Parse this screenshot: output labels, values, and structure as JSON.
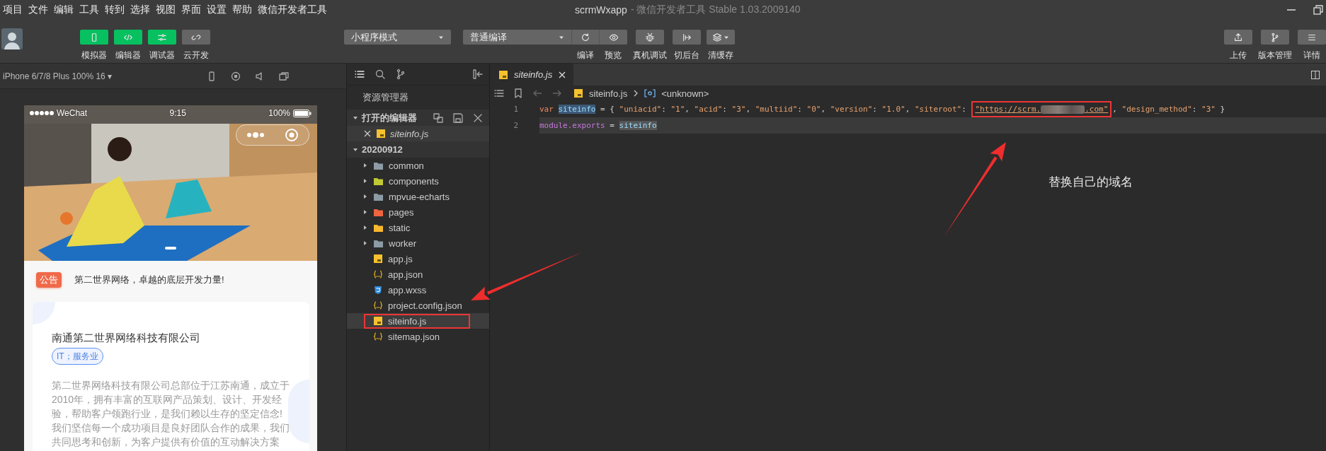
{
  "menu_bar": {
    "items": [
      "项目",
      "文件",
      "编辑",
      "工具",
      "转到",
      "选择",
      "视图",
      "界面",
      "设置",
      "帮助",
      "微信开发者工具"
    ],
    "title": "scrmWxapp",
    "subtitle": "- 微信开发者工具 Stable 1.03.2009140"
  },
  "toolbar": {
    "views": [
      {
        "label": "模拟器",
        "on": true
      },
      {
        "label": "编辑器",
        "on": true
      },
      {
        "label": "调试器",
        "on": true
      },
      {
        "label": "云开发",
        "on": false
      }
    ],
    "mode_select": "小程序模式",
    "compile": {
      "select": "普通编译",
      "buttons": [
        {
          "label": "编译"
        },
        {
          "label": "预览"
        }
      ]
    },
    "actions": [
      {
        "label": "真机调试",
        "dropdown": false
      },
      {
        "label": "切后台",
        "dropdown": false
      },
      {
        "label": "清缓存",
        "dropdown": true
      }
    ],
    "right_actions": [
      {
        "label": "上传"
      },
      {
        "label": "版本管理"
      },
      {
        "label": "详情"
      }
    ]
  },
  "simulator": {
    "device": "iPhone 6/7/8 Plus 100% 16 ▾",
    "phone": {
      "status": {
        "carrier": "WeChat",
        "time": "9:15",
        "battery": "100%"
      },
      "notice": {
        "badge": "公告",
        "text": "第二世界网络，卓越的底层开发力量!"
      },
      "company": {
        "name": "南通第二世界网络科技有限公司",
        "tag": "IT；服务业",
        "description": "第二世界网络科技有限公司总部位于江苏南通，成立于2010年，拥有丰富的互联网产品策划、设计、开发经验，帮助客户领跑行业，是我们赖以生存的坚定信念!我们坚信每一个成功项目是良好团队合作的成果，我们共同思考和创新，为客户提供有价值的互动解决方案"
      }
    }
  },
  "explorer": {
    "title": "资源管理器",
    "open_editors": {
      "label": "打开的编辑器",
      "expanded": true,
      "files": [
        {
          "name": "siteinfo.js",
          "kind": "js",
          "preview": true
        }
      ]
    },
    "project": {
      "label": "20200912",
      "expanded": true,
      "children": [
        {
          "name": "common",
          "kind": "folder",
          "color": "#8c9ba5",
          "expanded": false,
          "selected": false,
          "annotated": false
        },
        {
          "name": "components",
          "kind": "folder",
          "color": "#c0ca33",
          "expanded": false,
          "selected": false,
          "annotated": false
        },
        {
          "name": "mpvue-echarts",
          "kind": "folder",
          "color": "#8c9ba5",
          "expanded": false,
          "selected": false,
          "annotated": false
        },
        {
          "name": "pages",
          "kind": "folder",
          "color": "#f0643e",
          "expanded": false,
          "selected": false,
          "annotated": false
        },
        {
          "name": "static",
          "kind": "folder",
          "color": "#f9b72c",
          "expanded": false,
          "selected": false,
          "annotated": false
        },
        {
          "name": "worker",
          "kind": "folder",
          "color": "#8c9ba5",
          "expanded": false,
          "selected": false,
          "annotated": false
        },
        {
          "name": "app.js",
          "kind": "js",
          "selected": false,
          "annotated": false
        },
        {
          "name": "app.json",
          "kind": "json",
          "selected": false,
          "annotated": false
        },
        {
          "name": "app.wxss",
          "kind": "wxss",
          "selected": false,
          "annotated": false
        },
        {
          "name": "project.config.json",
          "kind": "json",
          "selected": false,
          "annotated": false
        },
        {
          "name": "siteinfo.js",
          "kind": "js",
          "selected": true,
          "annotated": true
        },
        {
          "name": "sitemap.json",
          "kind": "json",
          "selected": false,
          "annotated": false
        }
      ]
    }
  },
  "editor": {
    "tabs": [
      {
        "name": "siteinfo.js",
        "kind": "js",
        "selected": true,
        "preview": true
      }
    ],
    "breadcrumb": [
      {
        "text": "siteinfo.js",
        "kind": "file"
      },
      {
        "text": "<unknown>",
        "kind": "symbol"
      }
    ],
    "lines": [
      {
        "number": "1",
        "current": false,
        "tokens": [
          {
            "text": "var ",
            "kind": "keyword",
            "highlighted": false,
            "annotated": false
          },
          {
            "text": "siteinfo",
            "kind": "variable",
            "highlighted": true,
            "annotated": false
          },
          {
            "text": " = { ",
            "kind": "plain",
            "highlighted": false,
            "annotated": false
          },
          {
            "text": "\"uniacid\"",
            "kind": "string",
            "highlighted": false,
            "annotated": false
          },
          {
            "text": ": ",
            "kind": "plain",
            "highlighted": false,
            "annotated": false
          },
          {
            "text": "\"1\"",
            "kind": "string",
            "highlighted": false,
            "annotated": false
          },
          {
            "text": ", ",
            "kind": "plain",
            "highlighted": false,
            "annotated": false
          },
          {
            "text": "\"acid\"",
            "kind": "string",
            "highlighted": false,
            "annotated": false
          },
          {
            "text": ": ",
            "kind": "plain",
            "highlighted": false,
            "annotated": false
          },
          {
            "text": "\"3\"",
            "kind": "string",
            "highlighted": false,
            "annotated": false
          },
          {
            "text": ", ",
            "kind": "plain",
            "highlighted": false,
            "annotated": false
          },
          {
            "text": "\"multiid\"",
            "kind": "string",
            "highlighted": false,
            "annotated": false
          },
          {
            "text": ": ",
            "kind": "plain",
            "highlighted": false,
            "annotated": false
          },
          {
            "text": "\"0\"",
            "kind": "string",
            "highlighted": false,
            "annotated": false
          },
          {
            "text": ", ",
            "kind": "plain",
            "highlighted": false,
            "annotated": false
          },
          {
            "text": "\"version\"",
            "kind": "string",
            "highlighted": false,
            "annotated": false
          },
          {
            "text": ": ",
            "kind": "plain",
            "highlighted": false,
            "annotated": false
          },
          {
            "text": "\"1.0\"",
            "kind": "string",
            "highlighted": false,
            "annotated": false
          },
          {
            "text": ", ",
            "kind": "plain",
            "highlighted": false,
            "annotated": false
          },
          {
            "text": "\"siteroot\"",
            "kind": "string",
            "highlighted": false,
            "annotated": false
          },
          {
            "text": ": ",
            "kind": "plain",
            "highlighted": false,
            "annotated": false
          },
          {
            "text": "\"https://scrm.",
            "text_after": ".com\"",
            "kind": "link",
            "redacted": true,
            "highlighted": false,
            "annotated": true
          },
          {
            "text": ", ",
            "kind": "plain",
            "highlighted": false,
            "annotated": false
          },
          {
            "text": "\"design_method\"",
            "kind": "string",
            "highlighted": false,
            "annotated": false
          },
          {
            "text": ": ",
            "kind": "plain",
            "highlighted": false,
            "annotated": false
          },
          {
            "text": "\"3\"",
            "kind": "string",
            "highlighted": false,
            "annotated": false
          },
          {
            "text": " }",
            "kind": "plain",
            "highlighted": false,
            "annotated": false
          }
        ]
      },
      {
        "number": "2",
        "current": true,
        "tokens": [
          {
            "text": "module.exports",
            "kind": "builtin",
            "highlighted": false,
            "annotated": false
          },
          {
            "text": " = ",
            "kind": "plain",
            "highlighted": false,
            "annotated": false
          },
          {
            "text": "siteinfo",
            "kind": "variable",
            "highlighted": true,
            "annotated": false
          }
        ]
      }
    ]
  },
  "annotation": {
    "note": "替换自己的域名"
  }
}
